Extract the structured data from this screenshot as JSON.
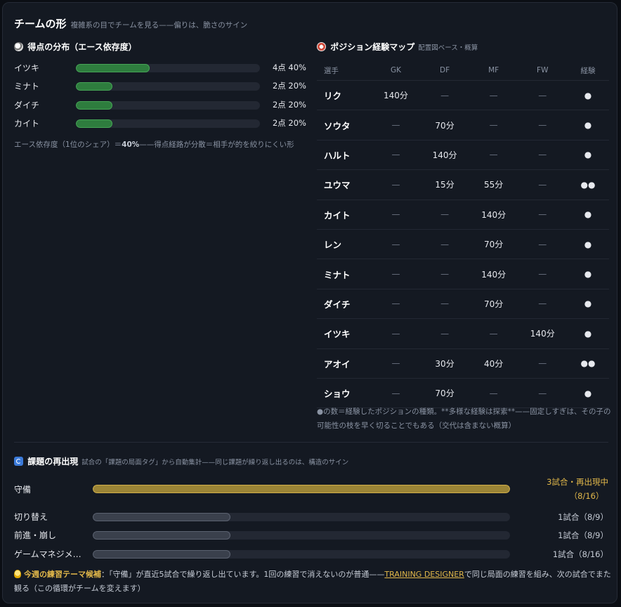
{
  "header": {
    "title": "チームの形",
    "subtitle": "複雑系の目でチームを見る——偏りは、脆さのサイン"
  },
  "score_distribution": {
    "title": "得点の分布（エース依存度）",
    "rows": [
      {
        "name": "イツキ",
        "value": "4点 40%",
        "share": 0.4
      },
      {
        "name": "ミナト",
        "value": "2点 20%",
        "share": 0.2
      },
      {
        "name": "ダイチ",
        "value": "2点 20%",
        "share": 0.2
      },
      {
        "name": "カイト",
        "value": "2点 20%",
        "share": 0.2
      }
    ],
    "note_prefix": "エース依存度（1位のシェア）＝",
    "note_value": "40%",
    "note_suffix": "——得点経路が分散＝相手が的を絞りにくい形"
  },
  "position_map": {
    "title": "ポジション経験マップ",
    "subtitle": "配置図ベース・概算",
    "columns": [
      "選手",
      "GK",
      "DF",
      "MF",
      "FW",
      "経験"
    ],
    "rows": [
      {
        "player": "リク",
        "gk": "140分",
        "df": "—",
        "mf": "—",
        "fw": "—",
        "exp": "●"
      },
      {
        "player": "ソウタ",
        "gk": "—",
        "df": "70分",
        "mf": "—",
        "fw": "—",
        "exp": "●"
      },
      {
        "player": "ハルト",
        "gk": "—",
        "df": "140分",
        "mf": "—",
        "fw": "—",
        "exp": "●"
      },
      {
        "player": "ユウマ",
        "gk": "—",
        "df": "15分",
        "mf": "55分",
        "fw": "—",
        "exp": "●●"
      },
      {
        "player": "カイト",
        "gk": "—",
        "df": "—",
        "mf": "140分",
        "fw": "—",
        "exp": "●"
      },
      {
        "player": "レン",
        "gk": "—",
        "df": "—",
        "mf": "70分",
        "fw": "—",
        "exp": "●"
      },
      {
        "player": "ミナト",
        "gk": "—",
        "df": "—",
        "mf": "140分",
        "fw": "—",
        "exp": "●"
      },
      {
        "player": "ダイチ",
        "gk": "—",
        "df": "—",
        "mf": "70分",
        "fw": "—",
        "exp": "●"
      },
      {
        "player": "イツキ",
        "gk": "—",
        "df": "—",
        "mf": "—",
        "fw": "140分",
        "exp": "●"
      },
      {
        "player": "アオイ",
        "gk": "—",
        "df": "30分",
        "mf": "40分",
        "fw": "—",
        "exp": "●●"
      },
      {
        "player": "ショウ",
        "gk": "—",
        "df": "70分",
        "mf": "—",
        "fw": "—",
        "exp": "●"
      }
    ],
    "note": "●の数＝経験したポジションの種類。**多様な経験は探索**——固定しすぎは、その子の可能性の枝を早く切ることでもある（交代は含まない概算）"
  },
  "recurring_issues": {
    "title": "課題の再出現",
    "subtitle": "試合の「課題の局面タグ」から自動集計——同じ課題が繰り返し出るのは、構造のサイン",
    "rows": [
      {
        "name": "守備",
        "value_line1": "3試合・再出現中",
        "value_line2": "（8/16）",
        "level": 1.0,
        "active": true
      },
      {
        "name": "切り替え",
        "value_line1": "1試合（8/9）",
        "value_line2": "",
        "level": 0.33,
        "active": false
      },
      {
        "name": "前進・崩し",
        "value_line1": "1試合（8/9）",
        "value_line2": "",
        "level": 0.33,
        "active": false
      },
      {
        "name": "ゲームマネジメ…",
        "value_line1": "1試合（8/16）",
        "value_line2": "",
        "level": 0.33,
        "active": false
      }
    ]
  },
  "tip": {
    "label": "今週の練習テーマ候補",
    "text_before": "：「守備」が直近5試合で繰り返し出ています。1回の練習で消えないのが普通——",
    "link": "TRAINING DESIGNER",
    "text_after": "で同じ局面の練習を組み、次の試合でまた観る（この循環がチームを変えます）"
  },
  "colors": {
    "accent_green": "#2e7d3e",
    "accent_gold": "#e2b84a",
    "background": "#141922"
  }
}
